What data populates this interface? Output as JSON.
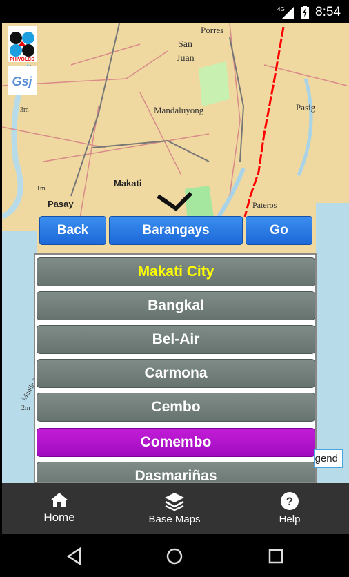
{
  "status_bar": {
    "network": "4G",
    "time": "8:54"
  },
  "map": {
    "labels": [
      "Porres",
      "San",
      "Juan",
      "Mandaluyong",
      "Pasig",
      "Makati",
      "Pasay",
      "Pateros",
      "Manila",
      "3m",
      "1m",
      "2m",
      "Manila Bay"
    ],
    "logos": [
      "PHIVOLCS",
      "GSJ"
    ],
    "fault_line_color": "#ff0000"
  },
  "toolbar": {
    "back": "Back",
    "title": "Barangays",
    "go": "Go"
  },
  "list": {
    "items": [
      {
        "label": "Makati City",
        "type": "header"
      },
      {
        "label": "Bangkal"
      },
      {
        "label": "Bel-Air"
      },
      {
        "label": "Carmona"
      },
      {
        "label": "Cembo"
      },
      {
        "label": "Comembo",
        "selected": true
      },
      {
        "label": "Dasmariñas"
      }
    ]
  },
  "legend_button": "Legend",
  "bottom_nav": {
    "home": "Home",
    "base_maps": "Base Maps",
    "help": "Help"
  },
  "colors": {
    "button_blue": "#2a7ae6",
    "item_gray": "#737f7b",
    "selected_purple": "#b015cb",
    "header_text": "#ffff00"
  }
}
